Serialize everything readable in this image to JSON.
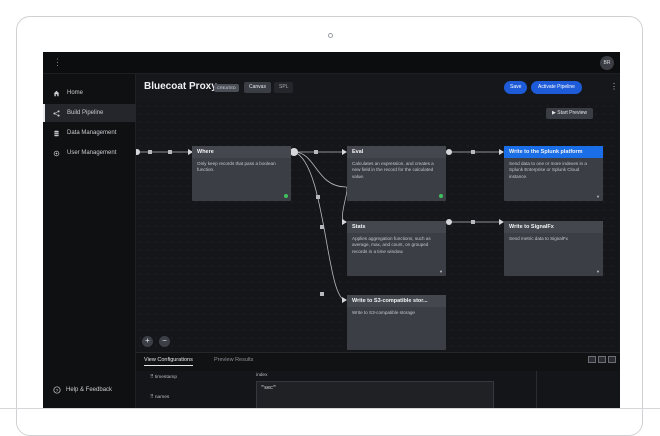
{
  "app": {
    "topbar": {
      "menu_glyph": "⋮",
      "avatar_initials": "BR"
    },
    "sidebar": {
      "items": [
        {
          "label": "Home",
          "icon": "home-icon"
        },
        {
          "label": "Build Pipeline",
          "icon": "pipeline-icon",
          "active": true
        },
        {
          "label": "Data Management",
          "icon": "database-icon"
        },
        {
          "label": "User Management",
          "icon": "gear-icon"
        }
      ],
      "help_label": "Help & Feedback"
    },
    "header": {
      "title": "Bluecoat Proxy",
      "badge": "CREATED",
      "tab_canvas": "Canvas",
      "tab_spl": "SPL",
      "save_label": "Save",
      "activate_label": "Activate Pipeline",
      "kebab": "⋮"
    },
    "canvas": {
      "start_preview_label": "▶ Start Preview",
      "nodes": {
        "where": {
          "title": "Where",
          "desc": "Only keep records that pass a boolean function."
        },
        "eval": {
          "title": "Eval",
          "desc": "Calculates an expression, and creates a new field in the record for the calculated value."
        },
        "splunk": {
          "title": "Write to the Splunk platform",
          "desc": "Send data to one or more indexes in a Splunk Enterprise or Splunk Cloud instance."
        },
        "stats": {
          "title": "Stats",
          "desc": "Applies aggregation functions, such as average, max, and count, on grouped records in a time window."
        },
        "signalfx": {
          "title": "Write to SignalFx",
          "desc": "Send metric data to SignalFx"
        },
        "s3": {
          "title": "Write to S3-compatible stor...",
          "desc": "Write to S3-compatible storage"
        }
      },
      "zoom_in": "+",
      "zoom_out": "−"
    },
    "bottom": {
      "tab_view": "View Configurations",
      "tab_preview": "Preview Results",
      "fields": [
        "timestamp",
        "names"
      ],
      "index_label": "index",
      "code_value": "\"sec\""
    },
    "colors": {
      "accent": "#1d5bd8",
      "selected_node": "#1a6ee8",
      "ok": "#3fc25d"
    }
  }
}
